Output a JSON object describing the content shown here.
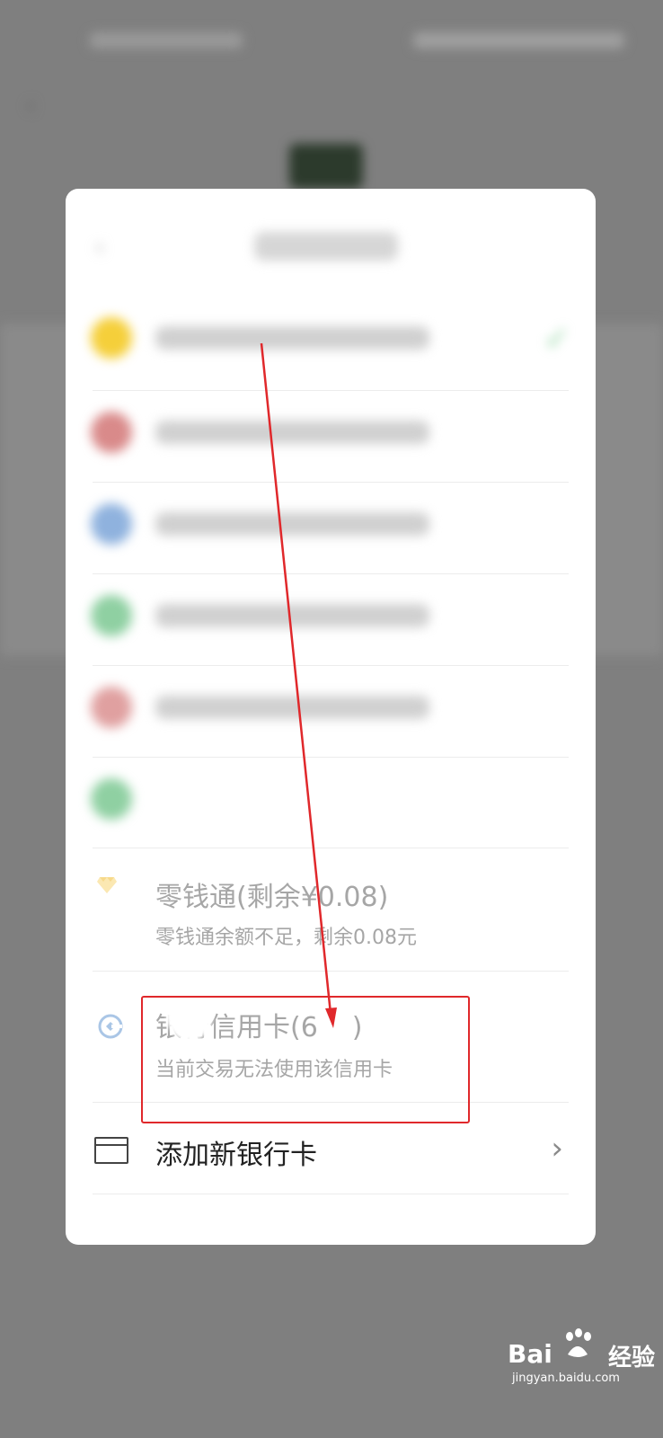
{
  "background": {
    "status_left": "",
    "status_right": ""
  },
  "dialog": {
    "title": "",
    "payment_methods": [
      {
        "name": "",
        "icon_color": "#f5cf3a",
        "selected": true
      },
      {
        "name": "",
        "icon_color": "#d46a6a"
      },
      {
        "name": "",
        "icon_color": "#6b9ad3"
      },
      {
        "name": "",
        "icon_color": "#6fbf86"
      },
      {
        "name": "",
        "icon_color": "#d46a6a"
      },
      {
        "name": "",
        "icon_color": "#6fbf86"
      }
    ],
    "change_wallet": {
      "title": "零钱通(剩余¥0.08)",
      "subtitle": "零钱通余额不足，剩余0.08元",
      "icon": "diamond-icon"
    },
    "credit_card": {
      "title_prefix": "",
      "title_main": "银行信用卡(6",
      "title_suffix": ")",
      "subtitle": "当前交易无法使用该信用卡",
      "icon": "bank-logo-icon"
    },
    "add_card": {
      "label": "添加新银行卡",
      "icon": "card-icon"
    }
  },
  "watermark": {
    "brand_left": "Bai",
    "brand_right": "经验",
    "url": "jingyan.baidu.com"
  },
  "colors": {
    "annotation_red": "#e0282b",
    "muted_text": "#a6a6a6",
    "overlay": "#7f7f7f"
  }
}
